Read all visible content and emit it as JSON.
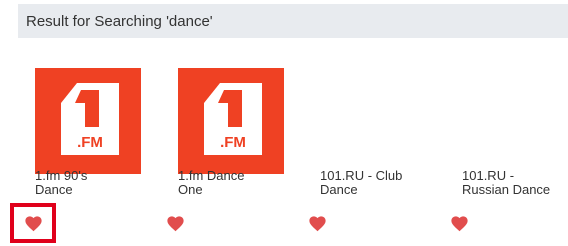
{
  "header": {
    "title": "Result for Searching 'dance'"
  },
  "results": [
    {
      "name_line1": "1.fm 90's",
      "name_line2": "Dance",
      "logo": "1fm-logo",
      "favorite_selected": true
    },
    {
      "name_line1": "1.fm Dance",
      "name_line2": "One",
      "logo": "1fm-logo",
      "favorite_selected": false
    },
    {
      "name_line1": "101.RU - Club",
      "name_line2": "Dance",
      "logo": null,
      "favorite_selected": false
    },
    {
      "name_line1": "101.RU -",
      "name_line2": "Russian Dance",
      "logo": null,
      "favorite_selected": false
    }
  ],
  "logo_text": ".FM",
  "colors": {
    "logo_bg": "#ef4123",
    "heart": "#e14d4d",
    "selection_outline": "#e0001b",
    "header_bg": "#e8ebef"
  }
}
